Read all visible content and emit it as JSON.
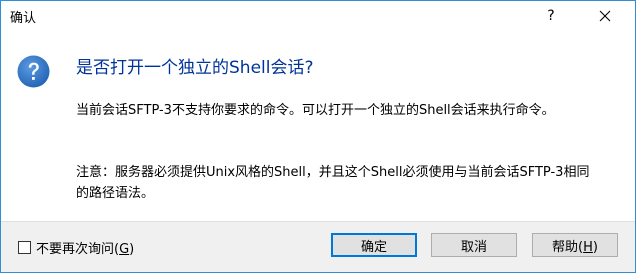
{
  "window": {
    "title": "确认",
    "help_glyph": "?",
    "close_icon": "close-icon"
  },
  "message": {
    "heading": "是否打开一个独立的Shell会话?",
    "paragraph1": "当前会话SFTP-3不支持你要求的命令。可以打开一个独立的Shell会话来执行命令。",
    "paragraph2": "注意：服务器必须提供Unix风格的Shell，并且这个Shell必须使用与当前会话SFTP-3相同的路径语法。",
    "icon": "question-icon"
  },
  "footer": {
    "checkbox_label_prefix": "不要再次询问(",
    "checkbox_accel": "G",
    "checkbox_label_suffix": ")",
    "checkbox_checked": false,
    "ok_label": "确定",
    "cancel_label": "取消",
    "help_label_prefix": "帮助(",
    "help_accel": "H",
    "help_label_suffix": ")"
  },
  "colors": {
    "border": "#2f8ed6",
    "heading": "#003399",
    "icon_fill": "#2d73c5",
    "footer_bg": "#f0f0f0",
    "default_button_border": "#0078d7"
  }
}
